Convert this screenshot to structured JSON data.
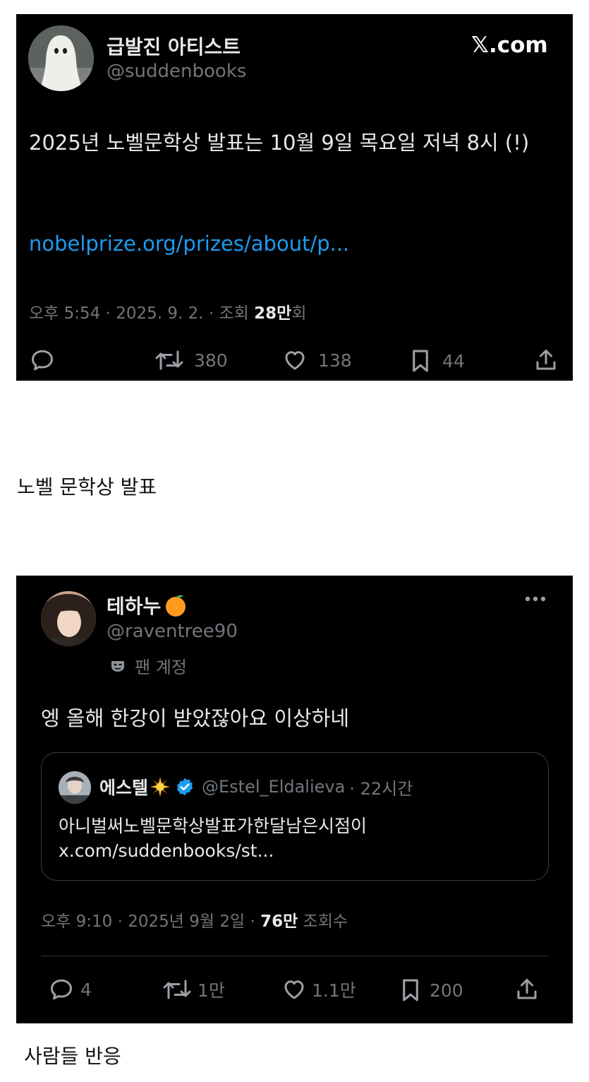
{
  "tweet1": {
    "display_name": "급발진 아티스트",
    "handle": "@suddenbooks",
    "brand": "𝕏.com",
    "text": "2025년 노벨문학상 발표는 10월 9일 목요일 저녁 8시 (!)",
    "link": "nobelprize.org/prizes/about/p...",
    "meta_prefix": "오후 5:54 · 2025. 9. 2. · 조회 ",
    "views": "28만",
    "meta_suffix": "회",
    "retweets": "380",
    "likes": "138",
    "bookmarks": "44"
  },
  "caption1": "노벨 문학상 발표",
  "tweet2": {
    "display_name": "테하누",
    "name_emoji": "orange-emoji",
    "handle": "@raventree90",
    "account_label": "팬 계정",
    "text": "엥 올해 한강이 받았잖아요 이상하네",
    "quote": {
      "display_name": "에스텔",
      "handle": "@Estel_Eldalieva",
      "time": "· 22시간",
      "text": "아니벌써노벨문학상발표가한달남은시점이",
      "link": "x.com/suddenbooks/st..."
    },
    "meta_prefix": "오후 9:10 · 2025년 9월 2일 · ",
    "views": "76만",
    "meta_suffix": " 조회수",
    "replies": "4",
    "retweets": "1만",
    "likes": "1.1만",
    "bookmarks": "200"
  },
  "caption2": "사람들 반응",
  "colors": {
    "card_bg": "#000000",
    "text": "#e7e9ea",
    "muted": "#71767b",
    "link": "#1d9bf0",
    "verified": "#1d9bf0"
  }
}
